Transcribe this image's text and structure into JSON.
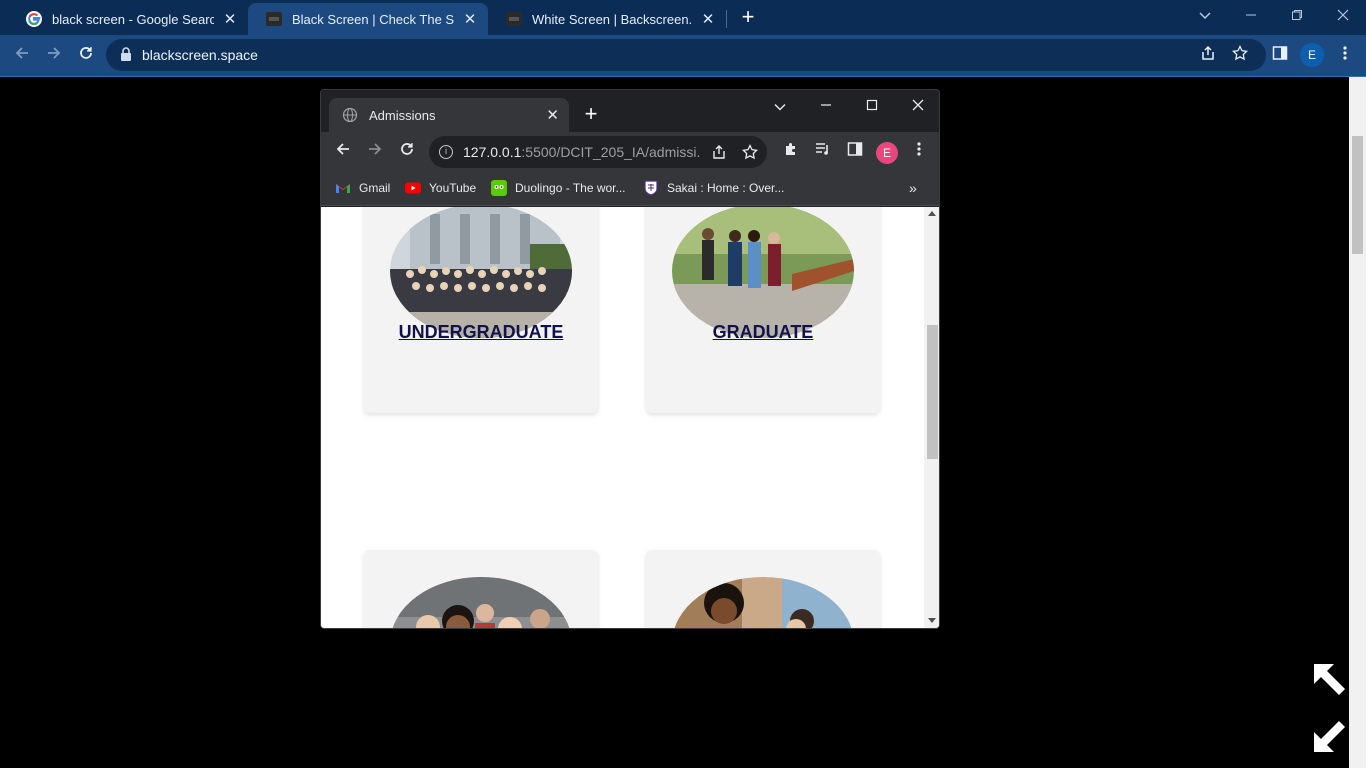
{
  "outer_browser": {
    "tabs": [
      {
        "title": "black screen - Google Search",
        "close": "✕"
      },
      {
        "title": "Black Screen | Check The Screen",
        "close": "✕"
      },
      {
        "title": "White Screen | Backscreen.Space",
        "close": "✕"
      }
    ],
    "new_tab": "+",
    "url": "blackscreen.space",
    "profile_initial": "E",
    "colors": {
      "tabbar": "#0b2d55",
      "toolbar": "#1c4a80"
    }
  },
  "inner_browser": {
    "tab_title": "Admissions",
    "tab_close": "✕",
    "new_tab": "+",
    "url_host": "127.0.0.1",
    "url_rest": ":5500/DCIT_205_IA/admissi...",
    "profile_initial": "E",
    "bookmarks": [
      {
        "label": "Gmail"
      },
      {
        "label": "YouTube"
      },
      {
        "label": "Duolingo - The wor..."
      },
      {
        "label": "Sakai : Home : Over..."
      }
    ],
    "bookmarks_more": "»"
  },
  "page": {
    "cards": [
      {
        "label": "UNDERGRADUATE"
      },
      {
        "label": "GRADUATE"
      },
      {
        "label": ""
      },
      {
        "label": ""
      }
    ]
  }
}
